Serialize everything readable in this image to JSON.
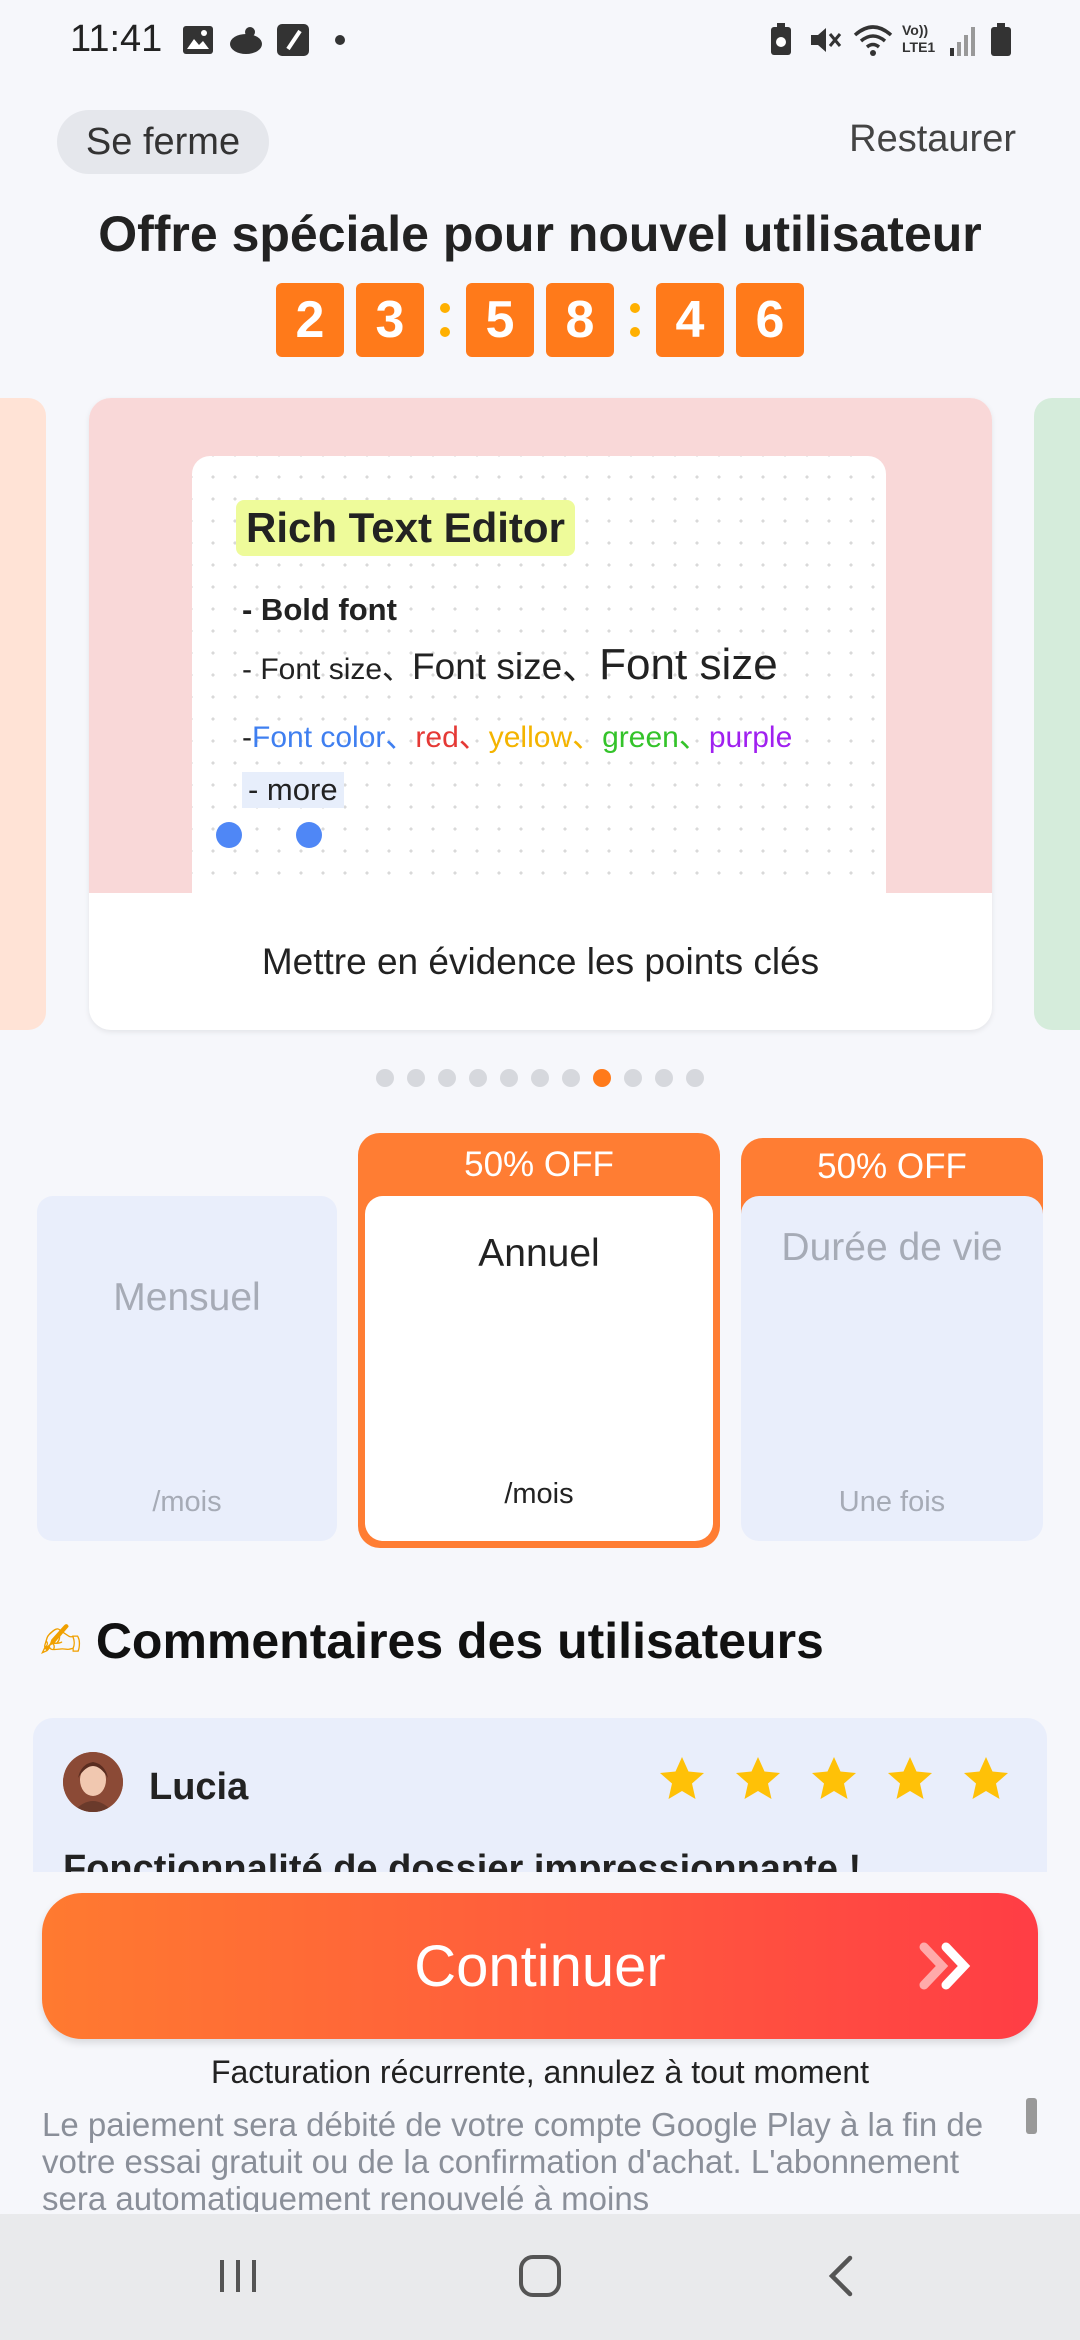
{
  "status_bar": {
    "time": "11:41",
    "left_icons": [
      "gallery-icon",
      "cloud-icon",
      "note-icon",
      "dot-icon"
    ],
    "right_icons": [
      "battery-saver-icon",
      "mute-icon",
      "wifi-icon",
      "volte-icon",
      "signal-icon",
      "battery-icon"
    ],
    "volte_label": "Vo))",
    "lte_label": "LTE1"
  },
  "header": {
    "close_label": "Se ferme",
    "restore_label": "Restaurer",
    "offer_title": "Offre spéciale pour nouvel utilisateur"
  },
  "countdown": {
    "digits": [
      "2",
      "3",
      "5",
      "8",
      "4",
      "6"
    ]
  },
  "carousel": {
    "preview": {
      "title": "Rich Text Editor",
      "bold_line": "- Bold font",
      "size_line": [
        "- Font size、",
        "Font size、",
        "Font size"
      ],
      "color_line": [
        "-",
        "Font color、",
        "red、",
        "yellow、",
        "green、",
        "purple"
      ],
      "color_values": [
        "#3f7ff0",
        "#e53935",
        "#f4b400",
        "#34c32a",
        "#a020f0"
      ],
      "more_line": "- more"
    },
    "caption": "Mettre en évidence les points clés",
    "page_count": 11,
    "active_page": 7
  },
  "plans": [
    {
      "name": "Mensuel",
      "sub": "/mois",
      "badge": ""
    },
    {
      "name": "Annuel",
      "sub": "/mois",
      "badge": "50% OFF"
    },
    {
      "name": "Durée de vie",
      "sub": "Une fois",
      "badge": "50% OFF"
    }
  ],
  "reviews": {
    "emoji": "✍",
    "title": "Commentaires des utilisateurs",
    "items": [
      {
        "name": "Lucia",
        "rating": 5,
        "title": "Fonctionnalité de dossier impressionnante !"
      }
    ]
  },
  "cta": {
    "continue_label": "Continuer",
    "billing_note": "Facturation récurrente, annulez à tout moment",
    "legal": "Le paiement sera débité de votre compte Google Play à la fin de votre essai gratuit ou de la confirmation d'achat. L'abonnement sera automatiquement renouvelé à moins"
  },
  "colors": {
    "accent": "#ff7a1a",
    "star": "#ffc107",
    "plan_bg": "#e9eefb"
  },
  "nav_bar": {
    "icons": [
      "recents-icon",
      "home-icon",
      "back-icon"
    ]
  }
}
